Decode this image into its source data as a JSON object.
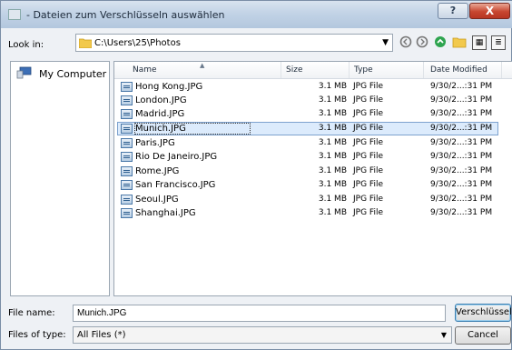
{
  "window": {
    "title": "- Dateien zum Verschlüsseln auswählen",
    "help_label": "?",
    "close_label": "X"
  },
  "lookin": {
    "label": "Look in:",
    "path": "C:\\Users\\25\\Photos"
  },
  "places": {
    "my_computer": "My Computer"
  },
  "columns": {
    "name": "Name",
    "size": "Size",
    "type": "Type",
    "date": "Date Modified"
  },
  "files": [
    {
      "name": "Hong Kong.JPG",
      "size": "3.1 MB",
      "type": "JPG File",
      "date": "9/30/2...:31 PM"
    },
    {
      "name": "London.JPG",
      "size": "3.1 MB",
      "type": "JPG File",
      "date": "9/30/2...:31 PM"
    },
    {
      "name": "Madrid.JPG",
      "size": "3.1 MB",
      "type": "JPG File",
      "date": "9/30/2...:31 PM"
    },
    {
      "name": "Munich.JPG",
      "size": "3.1 MB",
      "type": "JPG File",
      "date": "9/30/2...:31 PM"
    },
    {
      "name": "Paris.JPG",
      "size": "3.1 MB",
      "type": "JPG File",
      "date": "9/30/2...:31 PM"
    },
    {
      "name": "Rio De Janeiro.JPG",
      "size": "3.1 MB",
      "type": "JPG File",
      "date": "9/30/2...:31 PM"
    },
    {
      "name": "Rome.JPG",
      "size": "3.1 MB",
      "type": "JPG File",
      "date": "9/30/2...:31 PM"
    },
    {
      "name": "San Francisco.JPG",
      "size": "3.1 MB",
      "type": "JPG File",
      "date": "9/30/2...:31 PM"
    },
    {
      "name": "Seoul.JPG",
      "size": "3.1 MB",
      "type": "JPG File",
      "date": "9/30/2...:31 PM"
    },
    {
      "name": "Shanghai.JPG",
      "size": "3.1 MB",
      "type": "JPG File",
      "date": "9/30/2...:31 PM"
    }
  ],
  "selected_file": "Munich.JPG",
  "bottom": {
    "file_name_label": "File name:",
    "file_name_value": "Munich.JPG",
    "file_type_label": "Files of type:",
    "file_type_value": "All Files (*)",
    "encrypt_button": "Verschlüsseln",
    "cancel_button": "Cancel"
  },
  "icons": {
    "back": "circle-left-icon",
    "forward": "circle-right-icon",
    "up": "green-up-icon",
    "new_folder": "new-folder-icon",
    "list_view": "list-view-icon",
    "detail_view": "detail-view-icon"
  },
  "colors": {
    "selection": "#dcebfc",
    "title_gradient_top": "#d8e3ef",
    "close_button": "#c7462f"
  }
}
